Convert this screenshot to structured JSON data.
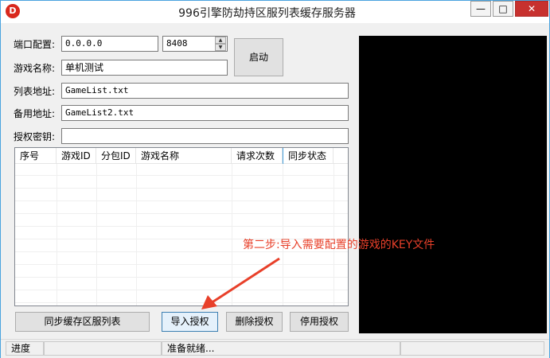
{
  "window": {
    "title": "996引擎防劫持区服列表缓存服务器",
    "icon_letter": "D",
    "minimize_glyph": "—",
    "maximize_glyph": "□",
    "close_glyph": "✕"
  },
  "form": {
    "port_label": "端口配置:",
    "ip_value": "0.0.0.0",
    "port_value": "8408",
    "game_name_label": "游戏名称:",
    "game_name_value": "单机测试",
    "list_url_label": "列表地址:",
    "list_url_value": "GameList.txt",
    "backup_url_label": "备用地址:",
    "backup_url_value": "GameList2.txt",
    "auth_key_label": "授权密钥:",
    "auth_key_value": ""
  },
  "buttons": {
    "start": "启动",
    "sync_cache": "同步缓存区服列表",
    "import_auth": "导入授权",
    "delete_auth": "删除授权",
    "backup_auth": "停用授权"
  },
  "table": {
    "columns": [
      "序号",
      "游戏ID",
      "分包ID",
      "游戏名称",
      "请求次数",
      "同步状态"
    ],
    "rows": []
  },
  "annotation": {
    "text": "第二步:导入需要配置的游戏的KEY文件",
    "color": "#e8402a"
  },
  "status": {
    "progress_label": "进度",
    "message": "准备就绪..."
  }
}
